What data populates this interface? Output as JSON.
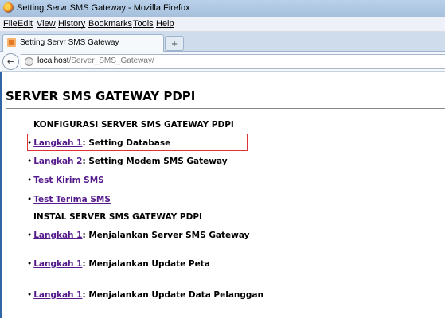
{
  "window": {
    "title": "Setting Servr SMS Gateway - Mozilla Firefox"
  },
  "menu": [
    "File",
    "Edit",
    "View",
    "History",
    "Bookmarks",
    "Tools",
    "Help"
  ],
  "tab": {
    "label": "Setting Servr SMS Gateway",
    "new_tab": "+"
  },
  "nav": {
    "back": "←",
    "url_host": "localhost",
    "url_path": "/Server_SMS_Gateway/"
  },
  "page": {
    "title": "SERVER SMS GATEWAY PDPI",
    "section1": "KONFIGURASI SERVER SMS GATEWAY PDPI",
    "section2": "INSTAL SERVER SMS GATEWAY PDPI",
    "bullet": "•",
    "items": [
      {
        "link": "Langkah 1",
        "rest": ": Setting Database"
      },
      {
        "link": "Langkah 2",
        "rest": ": Setting Modem SMS Gateway"
      },
      {
        "link": "Test Kirim SMS",
        "rest": ""
      },
      {
        "link": "Test Terima SMS",
        "rest": ""
      },
      {
        "link": "Langkah 1",
        "rest": ": Menjalankan Server SMS Gateway"
      },
      {
        "link": "Langkah 1",
        "rest": ": Menjalankan Update Peta"
      },
      {
        "link": "Langkah 1",
        "rest": ": Menjalankan Update Data Pelanggan"
      }
    ]
  }
}
